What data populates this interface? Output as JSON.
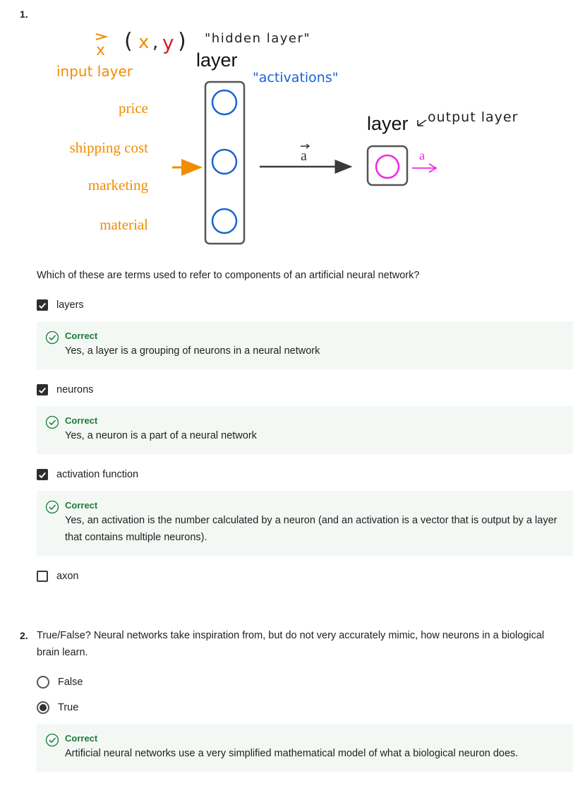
{
  "q1": {
    "number": "1.",
    "diagram": {
      "x_arrow_label": "x",
      "xy_label": "(x,y)",
      "hidden_layer_quote": "\"hidden layer\"",
      "layer_top": "layer",
      "input_layer": "input layer",
      "activations": "\"activations\"",
      "inputs": [
        "price",
        "shipping cost",
        "marketing",
        "material"
      ],
      "vector_label": "a",
      "output_layer_word": "layer",
      "output_layer_note": "output layer",
      "output_a": "a",
      "colors": {
        "orange": "#f28c00",
        "blue": "#1763d4",
        "magenta": "#ee2ae0",
        "red": "#d2202a"
      }
    },
    "prompt": "Which of these are terms used to refer to components of an artificial neural network?",
    "options": [
      {
        "label": "layers",
        "checked": true,
        "feedback_title": "Correct",
        "feedback": "Yes, a layer is a grouping of neurons in a neural network"
      },
      {
        "label": "neurons",
        "checked": true,
        "feedback_title": "Correct",
        "feedback": "Yes, a neuron is a part of a neural network"
      },
      {
        "label": "activation function",
        "checked": true,
        "feedback_title": "Correct",
        "feedback": "Yes, an activation is the number calculated by a neuron (and an activation is a vector that is output by a layer that contains multiple neurons)."
      },
      {
        "label": "axon",
        "checked": false
      }
    ]
  },
  "q2": {
    "number": "2.",
    "prompt": "True/False? Neural networks take inspiration from, but do not very accurately mimic, how neurons in a biological brain learn.",
    "options": [
      {
        "label": "False",
        "selected": false
      },
      {
        "label": "True",
        "selected": true
      }
    ],
    "feedback_title": "Correct",
    "feedback": "Artificial neural networks use a very simplified mathematical model of what a biological neuron does."
  }
}
